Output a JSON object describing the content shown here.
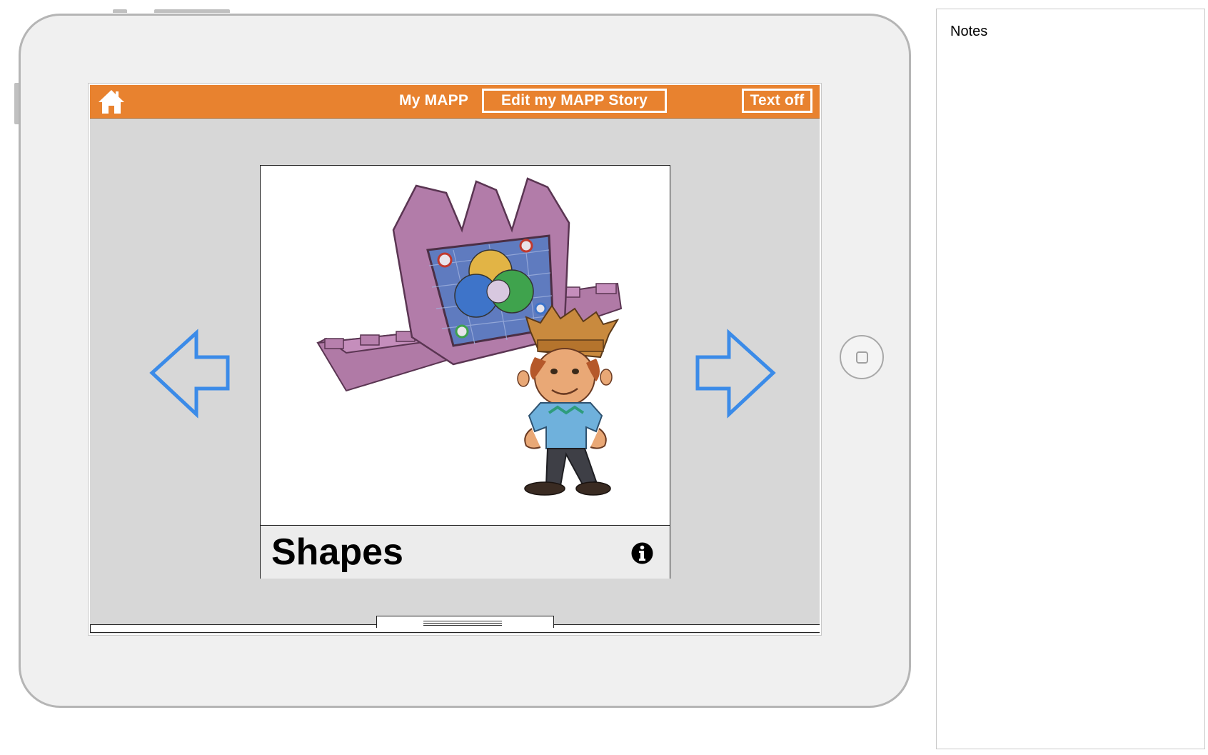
{
  "topbar": {
    "title": "My MAPP",
    "edit_button": "Edit my MAPP Story",
    "text_toggle": "Text off",
    "color": "#e8822f"
  },
  "card": {
    "title": "Shapes",
    "image_icon": "castle-and-king-illustration"
  },
  "navigation": {
    "prev_icon": "arrow-left-icon",
    "next_icon": "arrow-right-icon",
    "arrow_color": "#3b8be8"
  },
  "notes": {
    "title": "Notes"
  }
}
